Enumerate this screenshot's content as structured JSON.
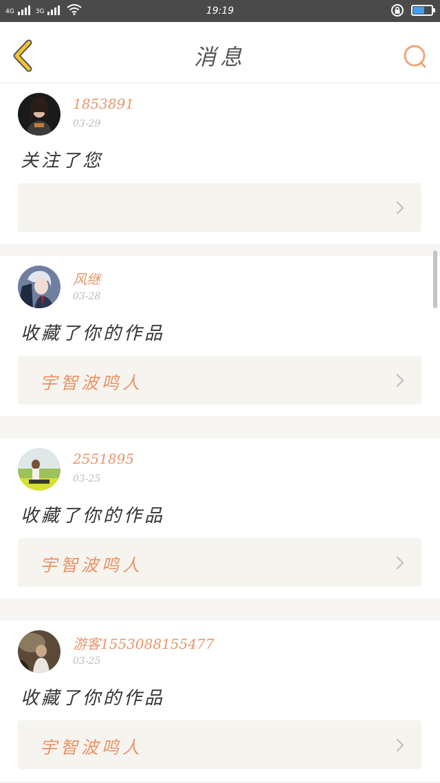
{
  "status_bar": {
    "network_1": "4G",
    "network_2": "3G",
    "time": "19:19",
    "battery_percent": 65
  },
  "header": {
    "title": "消息"
  },
  "colors": {
    "accent": "#eb9366",
    "back_arrow": "#f2c430",
    "card_bg": "#ffffff",
    "link_bg": "#f5f4ef"
  },
  "icons": {
    "back": "chevron-left-icon",
    "search": "search-icon",
    "link": "chevron-right-icon"
  },
  "messages": [
    {
      "user": "1853891",
      "date": "03-29",
      "action": "关注了您",
      "work": ""
    },
    {
      "user": "风继",
      "date": "03-28",
      "action": "收藏了你的作品",
      "work": "宇智波鸣人"
    },
    {
      "user": "2551895",
      "date": "03-25",
      "action": "收藏了你的作品",
      "work": "宇智波鸣人"
    },
    {
      "user": "游客1553088155477",
      "date": "03-25",
      "action": "收藏了你的作品",
      "work": "宇智波鸣人"
    }
  ]
}
